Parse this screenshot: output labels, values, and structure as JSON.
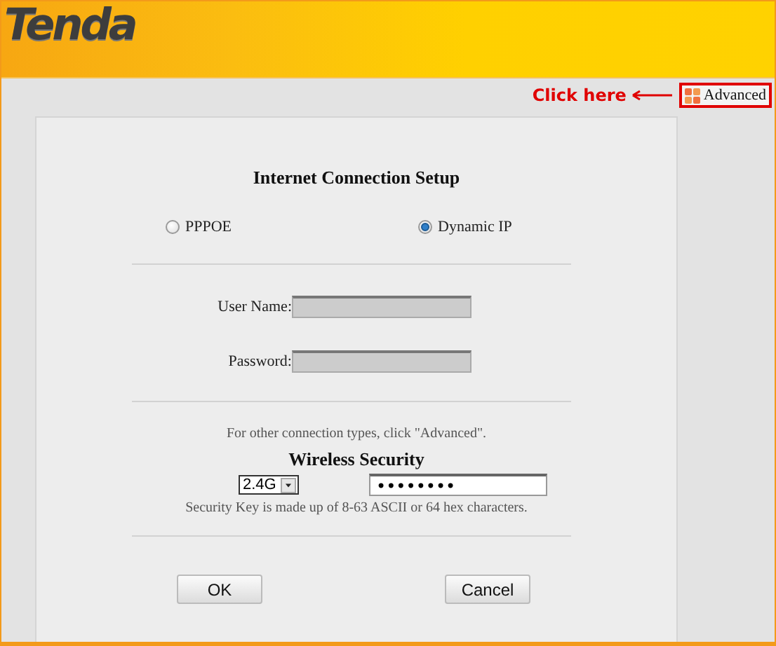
{
  "header": {
    "logo": "Tenda"
  },
  "annotation": {
    "text": "Click here"
  },
  "advanced_link": {
    "label": "Advanced"
  },
  "form": {
    "title": "Internet Connection Setup",
    "connection_types": [
      {
        "label": "PPPOE",
        "selected": false
      },
      {
        "label": "Dynamic IP",
        "selected": true
      }
    ],
    "fields": [
      {
        "label": "User Name:",
        "disabled": true
      },
      {
        "label": "Password:",
        "disabled": true
      }
    ],
    "note": "For other connection types, click \"Advanced\".",
    "wireless_title": "Wireless Security",
    "band": "2.4G",
    "security_key": "••••••••",
    "hint": "Security Key is made up of 8-63 ASCII or 64 hex characters.",
    "buttons": [
      "OK",
      "Cancel"
    ]
  }
}
